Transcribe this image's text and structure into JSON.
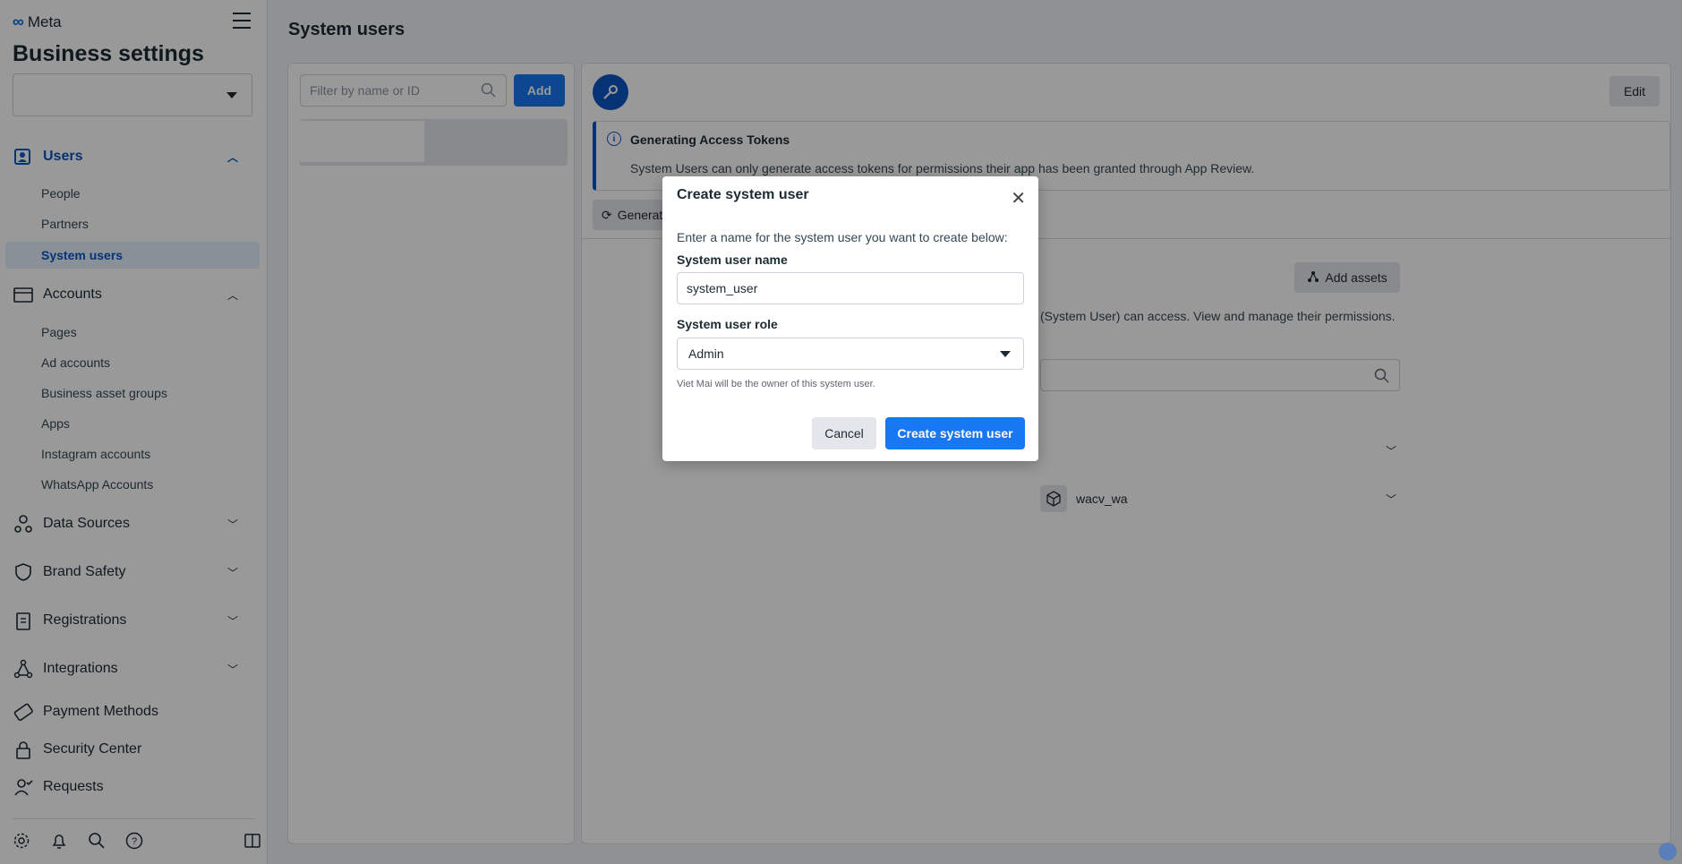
{
  "app": {
    "brand": "Meta",
    "title": "Business settings"
  },
  "sidebar": {
    "users": {
      "label": "Users",
      "items": [
        "People",
        "Partners",
        "System users"
      ]
    },
    "accounts": {
      "label": "Accounts",
      "items": [
        "Pages",
        "Ad accounts",
        "Business asset groups",
        "Apps",
        "Instagram accounts",
        "WhatsApp Accounts"
      ]
    },
    "sections": [
      "Data Sources",
      "Brand Safety",
      "Registrations",
      "Integrations",
      "Payment Methods",
      "Security Center",
      "Requests"
    ]
  },
  "main": {
    "title": "System users",
    "filter_placeholder": "Filter by name or ID",
    "add_label": "Add",
    "edit_label": "Edit",
    "info_title": "Generating Access Tokens",
    "info_body": "System Users can only generate access tokens for permissions their app has been granted through App Review.",
    "generate_label": "Generat",
    "add_assets_label": "Add assets",
    "assets_desc": "(System User) can access. View and manage their permissions.",
    "asset_name": "wacv_wa"
  },
  "modal": {
    "title": "Create system user",
    "instruction": "Enter a name for the system user you want to create below:",
    "name_label": "System user name",
    "name_value": "system_user",
    "role_label": "System user role",
    "role_value": "Admin",
    "owner_note": "Viet Mai will be the owner of this system user.",
    "cancel_label": "Cancel",
    "create_label": "Create system user"
  },
  "colors": {
    "primary": "#1877f2",
    "active_nav": "#0a56c2",
    "active_bg": "#e7f0fd"
  }
}
